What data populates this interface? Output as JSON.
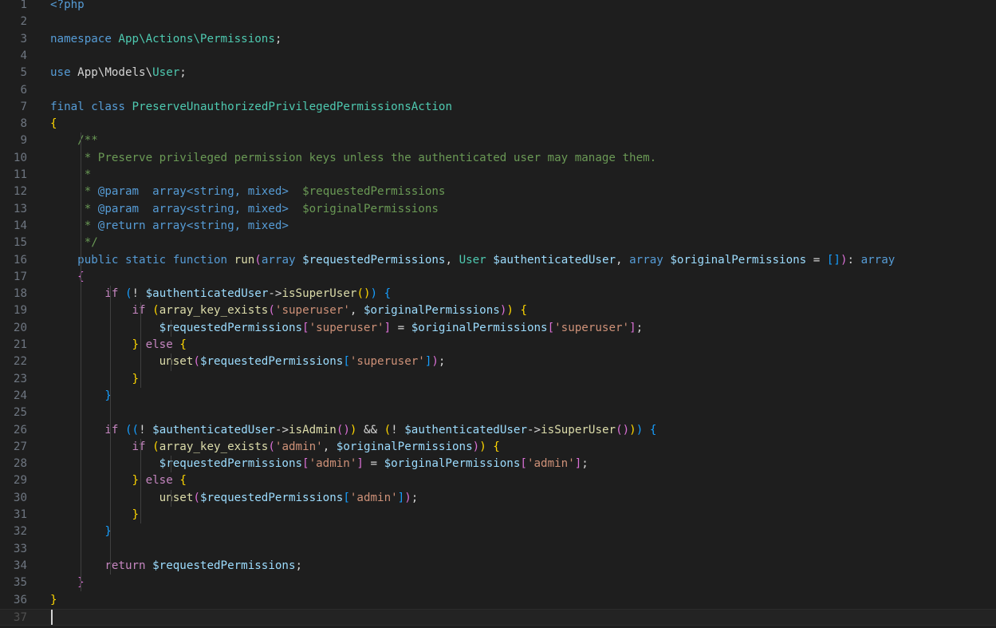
{
  "editor": {
    "language": "php",
    "theme_colors": {
      "background": "#1e1e1e",
      "line_number": "#6e7681",
      "keyword": "#569cd6",
      "type": "#4ec9b0",
      "function": "#dcdcaa",
      "variable": "#9cdcfe",
      "string": "#ce9178",
      "comment": "#6a9955",
      "bracket_gold": "#ffd700",
      "bracket_purple": "#da70d6",
      "bracket_blue": "#179fff"
    },
    "current_line": 37,
    "lines": [
      [
        [
          "tag",
          "<?php"
        ]
      ],
      [],
      [
        [
          "kw",
          "namespace"
        ],
        [
          "op",
          " "
        ],
        [
          "ns",
          "App\\Actions\\Permissions"
        ],
        [
          "op",
          ";"
        ]
      ],
      [],
      [
        [
          "kw",
          "use"
        ],
        [
          "op",
          " App\\Models\\"
        ],
        [
          "cl",
          "User"
        ],
        [
          "op",
          ";"
        ]
      ],
      [],
      [
        [
          "kw",
          "final"
        ],
        [
          "op",
          " "
        ],
        [
          "kw",
          "class"
        ],
        [
          "op",
          " "
        ],
        [
          "cl",
          "PreserveUnauthorizedPrivilegedPermissionsAction"
        ]
      ],
      [
        [
          "b1",
          "{"
        ]
      ],
      [
        [
          "op",
          "    "
        ],
        [
          "cmt",
          "/**"
        ]
      ],
      [
        [
          "op",
          "    "
        ],
        [
          "cmt",
          " * Preserve privileged permission keys unless the authenticated user may manage them."
        ]
      ],
      [
        [
          "op",
          "    "
        ],
        [
          "cmt",
          " *"
        ]
      ],
      [
        [
          "op",
          "    "
        ],
        [
          "cmt",
          " * "
        ],
        [
          "kw",
          "@param"
        ],
        [
          "cmt",
          "  "
        ],
        [
          "kw",
          "array<string, mixed>"
        ],
        [
          "cmt",
          "  $requestedPermissions"
        ]
      ],
      [
        [
          "op",
          "    "
        ],
        [
          "cmt",
          " * "
        ],
        [
          "kw",
          "@param"
        ],
        [
          "cmt",
          "  "
        ],
        [
          "kw",
          "array<string, mixed>"
        ],
        [
          "cmt",
          "  $originalPermissions"
        ]
      ],
      [
        [
          "op",
          "    "
        ],
        [
          "cmt",
          " * "
        ],
        [
          "kw",
          "@return"
        ],
        [
          "cmt",
          " "
        ],
        [
          "kw",
          "array<string, mixed>"
        ]
      ],
      [
        [
          "op",
          "    "
        ],
        [
          "cmt",
          " */"
        ]
      ],
      [
        [
          "op",
          "    "
        ],
        [
          "kw",
          "public"
        ],
        [
          "op",
          " "
        ],
        [
          "kw",
          "static"
        ],
        [
          "op",
          " "
        ],
        [
          "kw",
          "function"
        ],
        [
          "op",
          " "
        ],
        [
          "fn",
          "run"
        ],
        [
          "b2",
          "("
        ],
        [
          "kw",
          "array"
        ],
        [
          "op",
          " "
        ],
        [
          "var",
          "$requestedPermissions"
        ],
        [
          "op",
          ", "
        ],
        [
          "cl",
          "User"
        ],
        [
          "op",
          " "
        ],
        [
          "var",
          "$authenticatedUser"
        ],
        [
          "op",
          ", "
        ],
        [
          "kw",
          "array"
        ],
        [
          "op",
          " "
        ],
        [
          "var",
          "$originalPermissions"
        ],
        [
          "op",
          " = "
        ],
        [
          "b3",
          "[]"
        ],
        [
          "b2",
          ")"
        ],
        [
          "op",
          ": "
        ],
        [
          "kw",
          "array"
        ]
      ],
      [
        [
          "op",
          "    "
        ],
        [
          "b2",
          "{"
        ]
      ],
      [
        [
          "op",
          "        "
        ],
        [
          "ctl",
          "if"
        ],
        [
          "op",
          " "
        ],
        [
          "b3",
          "("
        ],
        [
          "op",
          "! "
        ],
        [
          "var",
          "$authenticatedUser"
        ],
        [
          "op",
          "->"
        ],
        [
          "fn",
          "isSuperUser"
        ],
        [
          "b1",
          "()"
        ],
        [
          "b3",
          ")"
        ],
        [
          "op",
          " "
        ],
        [
          "b3",
          "{"
        ]
      ],
      [
        [
          "op",
          "            "
        ],
        [
          "ctl",
          "if"
        ],
        [
          "op",
          " "
        ],
        [
          "b1",
          "("
        ],
        [
          "fn",
          "array_key_exists"
        ],
        [
          "b2",
          "("
        ],
        [
          "str",
          "'superuser'"
        ],
        [
          "op",
          ", "
        ],
        [
          "var",
          "$originalPermissions"
        ],
        [
          "b2",
          ")"
        ],
        [
          "b1",
          ")"
        ],
        [
          "op",
          " "
        ],
        [
          "b1",
          "{"
        ]
      ],
      [
        [
          "op",
          "                "
        ],
        [
          "var",
          "$requestedPermissions"
        ],
        [
          "b2",
          "["
        ],
        [
          "str",
          "'superuser'"
        ],
        [
          "b2",
          "]"
        ],
        [
          "op",
          " = "
        ],
        [
          "var",
          "$originalPermissions"
        ],
        [
          "b2",
          "["
        ],
        [
          "str",
          "'superuser'"
        ],
        [
          "b2",
          "]"
        ],
        [
          "op",
          ";"
        ]
      ],
      [
        [
          "op",
          "            "
        ],
        [
          "b1",
          "}"
        ],
        [
          "op",
          " "
        ],
        [
          "ctl",
          "else"
        ],
        [
          "op",
          " "
        ],
        [
          "b1",
          "{"
        ]
      ],
      [
        [
          "op",
          "                "
        ],
        [
          "fn",
          "unset"
        ],
        [
          "b2",
          "("
        ],
        [
          "var",
          "$requestedPermissions"
        ],
        [
          "b3",
          "["
        ],
        [
          "str",
          "'superuser'"
        ],
        [
          "b3",
          "]"
        ],
        [
          "b2",
          ")"
        ],
        [
          "op",
          ";"
        ]
      ],
      [
        [
          "op",
          "            "
        ],
        [
          "b1",
          "}"
        ]
      ],
      [
        [
          "op",
          "        "
        ],
        [
          "b3",
          "}"
        ]
      ],
      [],
      [
        [
          "op",
          "        "
        ],
        [
          "ctl",
          "if"
        ],
        [
          "op",
          " "
        ],
        [
          "b3",
          "(("
        ],
        [
          "op",
          "! "
        ],
        [
          "var",
          "$authenticatedUser"
        ],
        [
          "op",
          "->"
        ],
        [
          "fn",
          "isAdmin"
        ],
        [
          "b2",
          "()"
        ],
        [
          "b1",
          ")"
        ],
        [
          "op",
          " && "
        ],
        [
          "b1",
          "("
        ],
        [
          "op",
          "! "
        ],
        [
          "var",
          "$authenticatedUser"
        ],
        [
          "op",
          "->"
        ],
        [
          "fn",
          "isSuperUser"
        ],
        [
          "b2",
          "()"
        ],
        [
          "b1",
          ")"
        ],
        [
          "b3",
          ")"
        ],
        [
          "op",
          " "
        ],
        [
          "b3",
          "{"
        ]
      ],
      [
        [
          "op",
          "            "
        ],
        [
          "ctl",
          "if"
        ],
        [
          "op",
          " "
        ],
        [
          "b1",
          "("
        ],
        [
          "fn",
          "array_key_exists"
        ],
        [
          "b2",
          "("
        ],
        [
          "str",
          "'admin'"
        ],
        [
          "op",
          ", "
        ],
        [
          "var",
          "$originalPermissions"
        ],
        [
          "b2",
          ")"
        ],
        [
          "b1",
          ")"
        ],
        [
          "op",
          " "
        ],
        [
          "b1",
          "{"
        ]
      ],
      [
        [
          "op",
          "                "
        ],
        [
          "var",
          "$requestedPermissions"
        ],
        [
          "b2",
          "["
        ],
        [
          "str",
          "'admin'"
        ],
        [
          "b2",
          "]"
        ],
        [
          "op",
          " = "
        ],
        [
          "var",
          "$originalPermissions"
        ],
        [
          "b2",
          "["
        ],
        [
          "str",
          "'admin'"
        ],
        [
          "b2",
          "]"
        ],
        [
          "op",
          ";"
        ]
      ],
      [
        [
          "op",
          "            "
        ],
        [
          "b1",
          "}"
        ],
        [
          "op",
          " "
        ],
        [
          "ctl",
          "else"
        ],
        [
          "op",
          " "
        ],
        [
          "b1",
          "{"
        ]
      ],
      [
        [
          "op",
          "                "
        ],
        [
          "fn",
          "unset"
        ],
        [
          "b2",
          "("
        ],
        [
          "var",
          "$requestedPermissions"
        ],
        [
          "b3",
          "["
        ],
        [
          "str",
          "'admin'"
        ],
        [
          "b3",
          "]"
        ],
        [
          "b2",
          ")"
        ],
        [
          "op",
          ";"
        ]
      ],
      [
        [
          "op",
          "            "
        ],
        [
          "b1",
          "}"
        ]
      ],
      [
        [
          "op",
          "        "
        ],
        [
          "b3",
          "}"
        ]
      ],
      [],
      [
        [
          "op",
          "        "
        ],
        [
          "ctl",
          "return"
        ],
        [
          "op",
          " "
        ],
        [
          "var",
          "$requestedPermissions"
        ],
        [
          "op",
          ";"
        ]
      ],
      [
        [
          "op",
          "    "
        ],
        [
          "b2",
          "}"
        ]
      ],
      [
        [
          "b1",
          "}"
        ]
      ],
      []
    ]
  }
}
